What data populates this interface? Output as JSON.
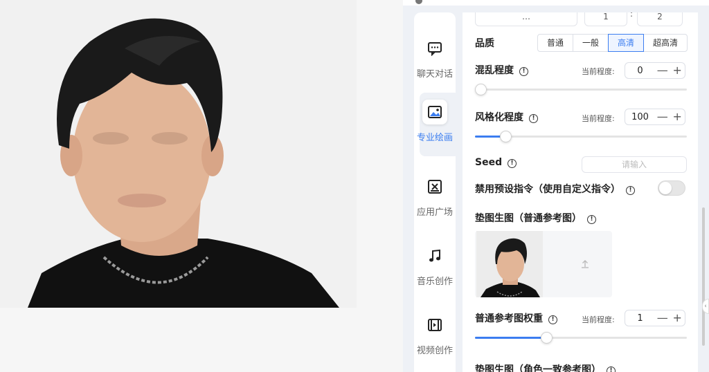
{
  "sidebar": {
    "items": [
      {
        "label": "聊天对话",
        "icon": "chat-icon",
        "active": false
      },
      {
        "label": "专业绘画",
        "icon": "image-icon",
        "active": true
      },
      {
        "label": "应用广场",
        "icon": "apps-icon",
        "active": false
      },
      {
        "label": "音乐创作",
        "icon": "music-icon",
        "active": false
      },
      {
        "label": "视频创作",
        "icon": "video-icon",
        "active": false
      }
    ]
  },
  "top_inputs": {
    "first": "…",
    "second": "1",
    "separator": ":",
    "third": "2"
  },
  "quality": {
    "label": "品质",
    "options": [
      "普通",
      "一般",
      "高清",
      "超高清"
    ],
    "selected": "高清"
  },
  "chaos": {
    "label": "混乱程度",
    "current_label": "当前程度:",
    "value": "0",
    "level": 0
  },
  "stylize": {
    "label": "风格化程度",
    "current_label": "当前程度:",
    "value": "100",
    "level": 0.125
  },
  "seed": {
    "label": "Seed",
    "placeholder": "请输入"
  },
  "disable_preset": {
    "label": "禁用预设指令（使用自定义指令）",
    "enabled": false
  },
  "image_ref": {
    "label": "垫图生图（普通参考图）"
  },
  "ref_weight": {
    "label": "普通参考图权重",
    "current_label": "当前程度:",
    "value": "1",
    "level": 0.33
  },
  "character_ref": {
    "label": "垫图生图（角色一致参考图）"
  },
  "stepper": {
    "minus": "—",
    "plus": "+"
  },
  "colors": {
    "accent": "#3b7df0",
    "highlight_border": "#e02020"
  }
}
